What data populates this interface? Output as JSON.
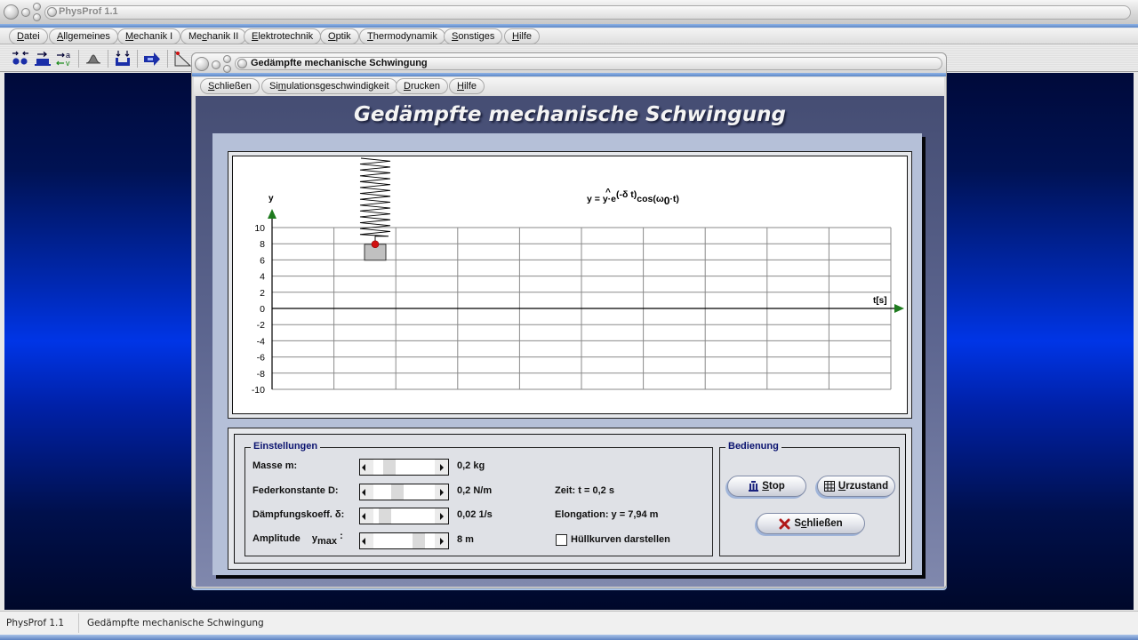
{
  "app": {
    "title": "PhysProf 1.1",
    "menu": [
      {
        "label": "Datei",
        "u": "D",
        "rest": "atei"
      },
      {
        "label": "Allgemeines",
        "u": "A",
        "rest": "llgemeines"
      },
      {
        "label": "Mechanik I",
        "u": "M",
        "rest": "echanik I"
      },
      {
        "label": "Mechanik II",
        "pre": "Me",
        "u": "c",
        "rest": "hanik II"
      },
      {
        "label": "Elektrotechnik",
        "u": "E",
        "rest": "lektrotechnik"
      },
      {
        "label": "Optik",
        "u": "O",
        "rest": "ptik"
      },
      {
        "label": "Thermodynamik",
        "u": "T",
        "rest": "hermodynamik"
      },
      {
        "label": "Sonstiges",
        "u": "S",
        "rest": "onstiges"
      },
      {
        "label": "Hilfe",
        "u": "H",
        "rest": "ilfe"
      }
    ],
    "toolbar": [
      "collision-icon",
      "force-block-icon",
      "acceleration-velocity-icon",
      "gauss-curve-icon",
      "vessel-pressure-icon",
      "arrow-right-icon",
      "inclined-plane-icon"
    ],
    "status": {
      "app_name": "PhysProf 1.1",
      "module": "Gedämpfte mechanische Schwingung"
    }
  },
  "dialog": {
    "title": "Gedämpfte mechanische Schwingung",
    "menu": [
      {
        "label": "Schließen",
        "u": "S",
        "rest": "chließen"
      },
      {
        "label": "Simulationsgeschwindigkeit",
        "pre": "Si",
        "u": "m",
        "rest": "ulationsgeschwindigkeit"
      },
      {
        "label": "Drucken",
        "u": "D",
        "rest": "rucken"
      },
      {
        "label": "Hilfe",
        "u": "H",
        "rest": "ilfe"
      }
    ],
    "heading": "Gedämpfte mechanische Schwingung"
  },
  "chart_data": {
    "type": "line",
    "title": "",
    "formula": {
      "lhs": "y = ",
      "yhat": "y",
      "dot_e": "·e",
      "exponent": "(-δ t)",
      "cos": "cos(ω",
      "sub": "0",
      "tail": "·t)"
    },
    "xlabel": "t[s]",
    "ylabel": "y",
    "ylim": [
      -10,
      10
    ],
    "y_ticks": [
      10,
      8,
      6,
      4,
      2,
      0,
      -2,
      -4,
      -6,
      -8,
      -10
    ],
    "x_divisions": 10,
    "grid": true,
    "series": [
      {
        "name": "Elongation",
        "x": [
          0.2
        ],
        "y": [
          7.94
        ]
      }
    ],
    "mass_position_y": 7.94,
    "axis_arrow_color": "#1e7a1e",
    "point_color": "#d01010"
  },
  "settings": {
    "group_title": "Einstellungen",
    "rows": [
      {
        "label": "Masse m:",
        "value": "0,2 kg",
        "slider_fraction": 0.2
      },
      {
        "label": "Federkonstante D:",
        "value": "0,2 N/m",
        "slider_fraction": 0.37
      },
      {
        "label": "Dämpfungskoeff. δ:",
        "value": "0,02 1/s",
        "slider_fraction": 0.1
      },
      {
        "label": "Amplitude",
        "label_sym": "y",
        "label_sub": "max",
        "label_colon": ":",
        "value": "8 m",
        "slider_fraction": 0.8
      }
    ],
    "time_readout": "Zeit: t = 0,2 s",
    "elongation_readout": "Elongation: y = 7,94 m",
    "envelope_checkbox": {
      "label": "Hüllkurven darstellen",
      "checked": false
    }
  },
  "controls": {
    "group_title": "Bedienung",
    "stop": {
      "u": "S",
      "rest": "top",
      "icon": "pause-bars-icon"
    },
    "reset": {
      "u": "U",
      "rest": "rzustand",
      "icon": "grid-reset-icon"
    },
    "close": {
      "pre": "S",
      "u": "c",
      "rest": "hließen",
      "icon": "close-x-icon",
      "icon_color": "#b01818"
    }
  }
}
